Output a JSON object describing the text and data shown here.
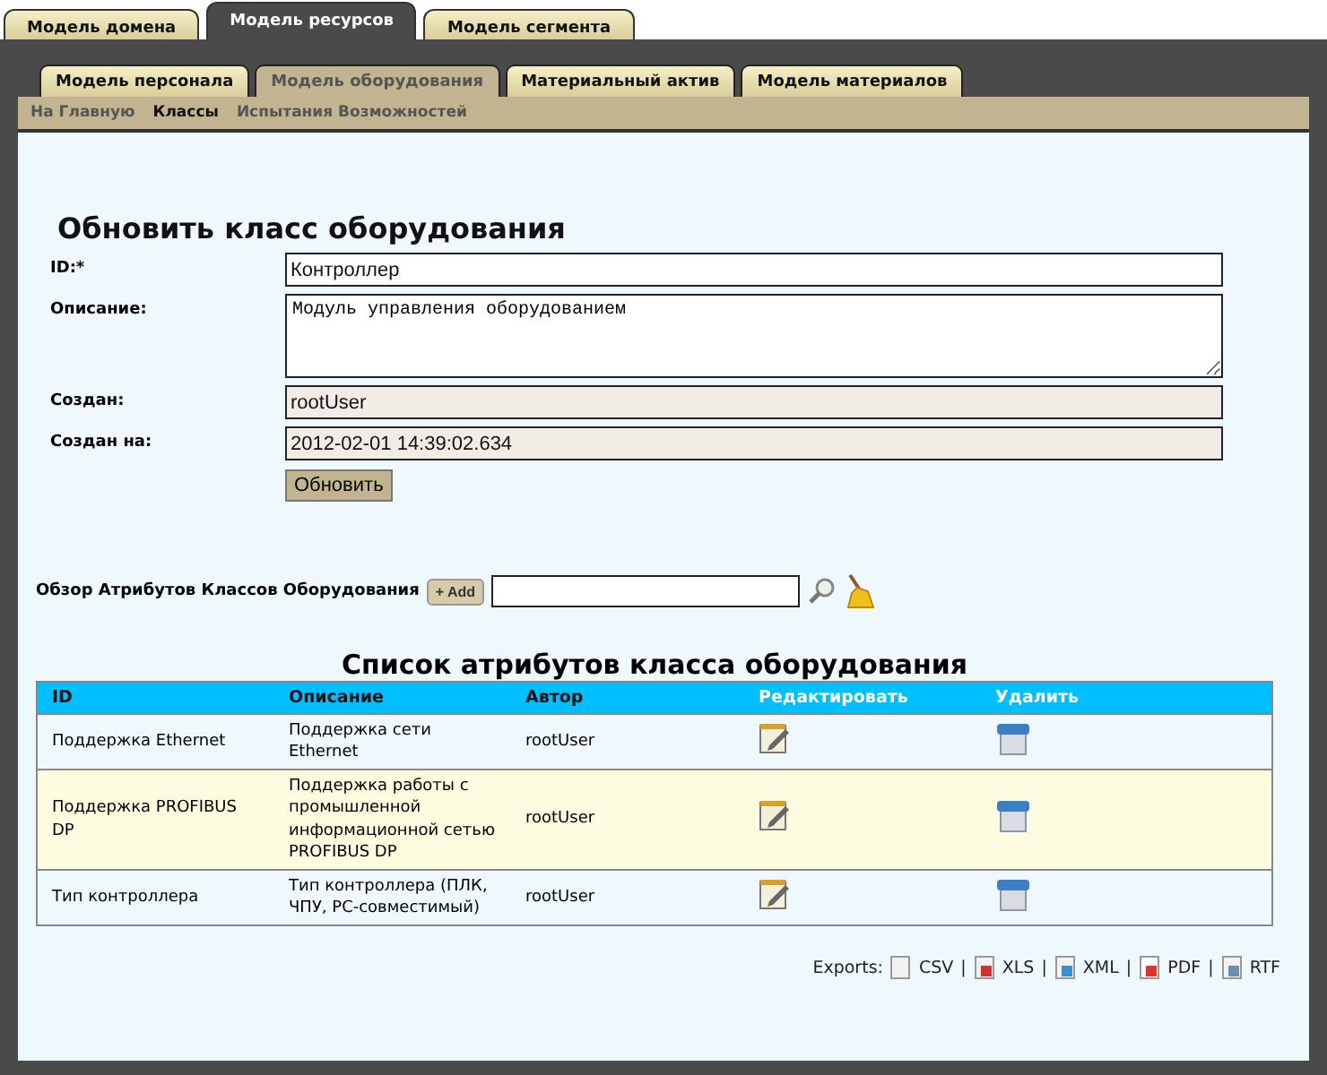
{
  "top_tabs": [
    {
      "label": "Модель домена",
      "selected": false
    },
    {
      "label": "Модель ресурсов",
      "selected": true
    },
    {
      "label": "Модель сегмента",
      "selected": false
    }
  ],
  "sub_tabs": [
    {
      "label": "Модель персонала",
      "selected": false
    },
    {
      "label": "Модель оборудования",
      "selected": true
    },
    {
      "label": "Материальный актив",
      "selected": false
    },
    {
      "label": "Модель материалов",
      "selected": false
    }
  ],
  "nav": [
    {
      "label": "На Главную",
      "selected": false
    },
    {
      "label": "Классы",
      "selected": true
    },
    {
      "label": "Испытания Возможностей",
      "selected": false
    }
  ],
  "form": {
    "title": "Обновить класс оборудования",
    "fields": [
      {
        "label": "ID:*",
        "value": "Контроллер",
        "kind": "text",
        "disabled": false
      },
      {
        "label": "Описание:",
        "value": "Модуль управления оборудованием",
        "kind": "textarea",
        "disabled": false
      },
      {
        "label": "Создан:",
        "value": "rootUser",
        "kind": "text",
        "disabled": true
      },
      {
        "label": "Создан на:",
        "value": "2012-02-01 14:39:02.634",
        "kind": "text",
        "disabled": true
      }
    ],
    "submit": "Обновить"
  },
  "browse": {
    "label": "Обзор Атрибутов Классов Оборудования",
    "add_button": "+ Add"
  },
  "table": {
    "title": "Список атрибутов класса оборудования",
    "columns": [
      "ID",
      "Описание",
      "Автор",
      "Редактировать",
      "Удалить"
    ],
    "rows": [
      {
        "id": "Поддержка Ethernet",
        "description": "Поддержка сети Ethernet",
        "author": "rootUser",
        "highlighted": false
      },
      {
        "id": "Поддержка PROFIBUS DP",
        "description": "Поддержка работы с промышленной информационной сетью PROFIBUS DP",
        "author": "rootUser",
        "highlighted": true
      },
      {
        "id": "Тип контроллера",
        "description": "Тип контроллера (ПЛК, ЧПУ, PC-совместимый)",
        "author": "rootUser",
        "highlighted": false
      }
    ]
  },
  "exports": {
    "label": "Exports:",
    "separator": "|",
    "formats": [
      {
        "label": "CSV",
        "kind": "csv"
      },
      {
        "label": "XLS",
        "kind": "xls"
      },
      {
        "label": "XML",
        "kind": "xml"
      },
      {
        "label": "PDF",
        "kind": "pdf"
      },
      {
        "label": "RTF",
        "kind": "rtf"
      }
    ]
  }
}
